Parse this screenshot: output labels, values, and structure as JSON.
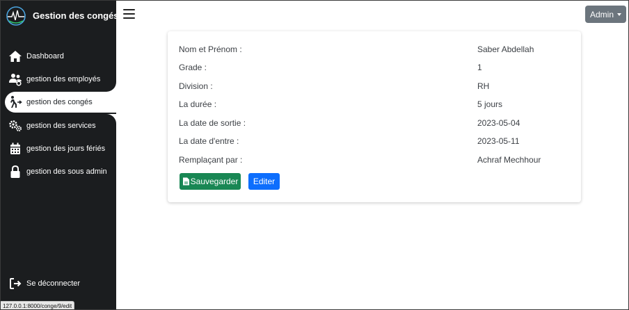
{
  "brand": {
    "title": "Gestion des congés",
    "logo_icon": "heartbeat-logo-icon"
  },
  "sidebar": {
    "items": [
      {
        "label": "Dashboard",
        "icon": "home-icon"
      },
      {
        "label": "gestion des employés",
        "icon": "users-gear-icon"
      },
      {
        "label": "gestion des congés",
        "icon": "person-walking-arrow-icon",
        "active": true
      },
      {
        "label": "gestion des services",
        "icon": "gears-icon"
      },
      {
        "label": "gestion des jours fériés",
        "icon": "calendar-icon"
      },
      {
        "label": "gestion des sous admin",
        "icon": "lock-icon"
      }
    ],
    "logout": {
      "label": "Se déconnecter",
      "icon": "logout-icon"
    }
  },
  "topbar": {
    "menu_icon": "hamburger-icon",
    "admin_label": "Admin"
  },
  "details": {
    "rows": [
      {
        "label": "Nom et Prénom :",
        "value": "Saber Abdellah"
      },
      {
        "label": "Grade :",
        "value": "1"
      },
      {
        "label": "Division :",
        "value": "RH"
      },
      {
        "label": "La durée :",
        "value": "5 jours"
      },
      {
        "label": "La date de sortie :",
        "value": "2023-05-04"
      },
      {
        "label": "La date d'entre :",
        "value": "2023-05-11"
      },
      {
        "label": "Remplaçant par :",
        "value": "Achraf Mechhour"
      }
    ],
    "save_label": "Sauvegarder",
    "edit_label": "Editer"
  },
  "status_url": "127.0.0.1:8000/conge/9/edit",
  "colors": {
    "sidebar_bg": "#1b1d1f",
    "save_button": "#198754",
    "edit_button": "#0d6efd",
    "admin_button": "#6c757d"
  }
}
